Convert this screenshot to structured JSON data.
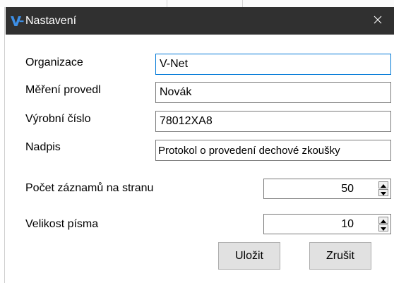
{
  "window": {
    "title": "Nastavení",
    "icon": "v-net-logo-icon",
    "close_icon": "close-icon",
    "titlebar_color": "#303030",
    "accent_color": "#0078d7"
  },
  "form": {
    "organizace": {
      "label": "Organizace",
      "value": "V-Net"
    },
    "mereni": {
      "label": "Měření provedl",
      "value": "Novák"
    },
    "vyrobni": {
      "label": "Výrobní číslo",
      "value": "78012XA8"
    },
    "nadpis": {
      "label": "Nadpis",
      "value": "Protokol o provedení dechové zkoušky"
    },
    "pocet": {
      "label": "Počet záznamů na stranu",
      "value": "50"
    },
    "velikost": {
      "label": "Velikost písma",
      "value": "10"
    }
  },
  "buttons": {
    "save": "Uložit",
    "cancel": "Zrušit"
  }
}
